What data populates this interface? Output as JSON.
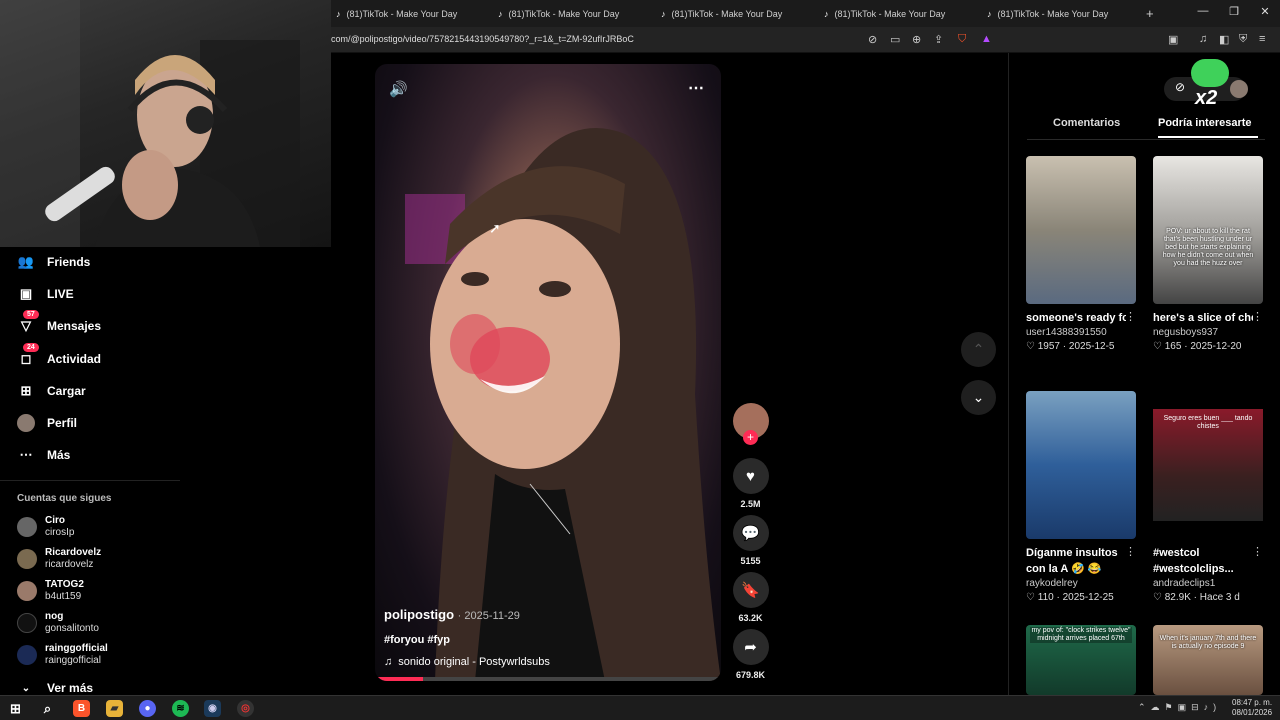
{
  "browser": {
    "tabs": [
      {
        "label": "(81)TikTok - Make Your Day"
      },
      {
        "label": "(81)TikTok - Make Your Day"
      },
      {
        "label": "(81)TikTok - Make Your Day"
      },
      {
        "label": "(81)TikTok - Make Your Day"
      },
      {
        "label": "(81)TikTok - Make Your Day"
      }
    ],
    "new_tab": "+",
    "url": "com/@polipostigo/video/7578215443190549780?_r=1&_t=ZM-92ufIrJRBoC"
  },
  "sidebar": {
    "items": [
      {
        "label": "Friends",
        "icon": "friends-icon"
      },
      {
        "label": "LIVE",
        "icon": "live-icon"
      },
      {
        "label": "Mensajes",
        "icon": "messages-icon",
        "badge": "57"
      },
      {
        "label": "Actividad",
        "icon": "activity-icon",
        "badge": "24"
      },
      {
        "label": "Cargar",
        "icon": "upload-icon"
      },
      {
        "label": "Perfil",
        "icon": "profile-avatar"
      },
      {
        "label": "Más",
        "icon": "more-icon"
      }
    ],
    "following_title": "Cuentas que sigues",
    "following": [
      {
        "name": "Ciro",
        "handle": "cirosIp"
      },
      {
        "name": "Ricardovelz",
        "handle": "ricardovelz"
      },
      {
        "name": "TATOG2",
        "handle": "b4ut159"
      },
      {
        "name": "nog",
        "handle": "gonsalitonto"
      },
      {
        "name": "rainggofficial",
        "handle": "rainggofficial"
      }
    ],
    "see_more": "Ver más"
  },
  "video": {
    "author": "polipostigo",
    "date": "· 2025-11-29",
    "hashtags": "#foryou #fyp",
    "sound": "sonido original - Postywrldsubs",
    "progress": 0.14
  },
  "actions": {
    "likes": "2.5M",
    "comments": "5155",
    "saves": "63.2K",
    "shares": "679.8K"
  },
  "right_panel": {
    "tab_comments": "Comentarios",
    "tab_suggested": "Podría interesarte",
    "overlay_text": "x2",
    "cards": [
      {
        "title": "someone's ready for crate day 🍻...",
        "user": "user14388391550",
        "likes": "1957",
        "date": "2025-12-5",
        "thumb_caption": ""
      },
      {
        "title": "here's a slice of cheese don't...",
        "user": "negusboys937",
        "likes": "165",
        "date": "2025-12-20",
        "thumb_caption": "POV: ur about to kill the rat that's been hustling under ur bed but he starts explaining how he didn't come out when you had the huzz over"
      },
      {
        "title": "Díganme insultos con la A 🤣 😂 😂...",
        "user": "raykodelrey",
        "likes": "110",
        "date": "2025-12-25",
        "thumb_caption": ""
      },
      {
        "title": "#westcol #westcolclips...",
        "user": "andradeclips1",
        "likes": "82.9K",
        "date": "Hace 3 d",
        "thumb_caption": "Seguro eres buen ___ tando chistes"
      },
      {
        "title": "",
        "user": "",
        "likes": "",
        "date": "",
        "thumb_caption": "my pov of: \"clock strikes twelve\" midnight arrives placed 67th"
      },
      {
        "title": "",
        "user": "",
        "likes": "",
        "date": "",
        "thumb_caption": "When it's january 7th and there is actually no episode 9"
      }
    ]
  },
  "taskbar": {
    "time": "08:47 p. m.",
    "date": "08/01/2026"
  }
}
